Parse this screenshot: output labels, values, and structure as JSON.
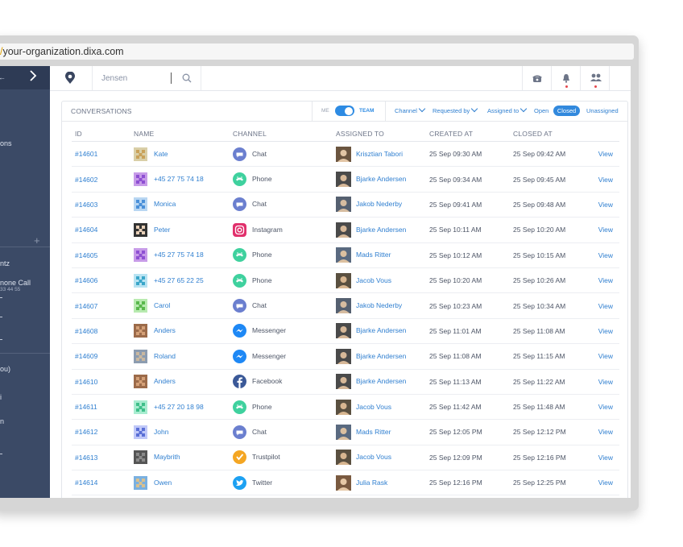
{
  "browser": {
    "url_prefix": "/",
    "url_host": "your-organization.dixa.com"
  },
  "sidebar": {
    "collapse_arrow_label": "",
    "fragments": [
      "ons",
      "ntz",
      "none Call",
      "33 44 55",
      "ou)",
      "i",
      "n"
    ]
  },
  "topbar": {
    "search_value": "Jensen"
  },
  "panel": {
    "title": "CONVERSATIONS",
    "toggle": {
      "me_label": "ME",
      "team_label": "TEAM"
    },
    "filters": {
      "channel": "Channel",
      "requested_by": "Requested by",
      "assigned_to": "Assigned to",
      "open": "Open",
      "closed": "Closed",
      "unassigned": "Unassigned"
    }
  },
  "table": {
    "headers": [
      "ID",
      "NAME",
      "CHANNEL",
      "ASSIGNED TO",
      "CREATED AT",
      "CLOSED AT"
    ],
    "view_label": "View",
    "rows": [
      {
        "id": "#14601",
        "name": "Kate",
        "channel": "Chat",
        "assigned": "Krisztian Tabori",
        "created": "25 Sep 09:30 AM",
        "closed": "25 Sep 09:42 AM"
      },
      {
        "id": "#14602",
        "name": "+45 27 75 74 18",
        "channel": "Phone",
        "assigned": "Bjarke Andersen",
        "created": "25 Sep 09:34 AM",
        "closed": "25 Sep 09:45 AM"
      },
      {
        "id": "#14603",
        "name": "Monica",
        "channel": "Chat",
        "assigned": "Jakob Nederby",
        "created": "25 Sep 09:41 AM",
        "closed": "25 Sep 09:48 AM"
      },
      {
        "id": "#14604",
        "name": "Peter",
        "channel": "Instagram",
        "assigned": "Bjarke Andersen",
        "created": "25 Sep 10:11 AM",
        "closed": "25 Sep 10:20 AM"
      },
      {
        "id": "#14605",
        "name": "+45 27 75 74 18",
        "channel": "Phone",
        "assigned": "Mads Ritter",
        "created": "25 Sep 10:12 AM",
        "closed": "25 Sep 10:15 AM"
      },
      {
        "id": "#14606",
        "name": "+45 27 65 22 25",
        "channel": "Phone",
        "assigned": "Jacob Vous",
        "created": "25 Sep 10:20 AM",
        "closed": "25 Sep 10:26 AM"
      },
      {
        "id": "#14607",
        "name": "Carol",
        "channel": "Chat",
        "assigned": "Jakob Nederby",
        "created": "25 Sep 10:23 AM",
        "closed": "25 Sep 10:34 AM"
      },
      {
        "id": "#14608",
        "name": "Anders",
        "channel": "Messenger",
        "assigned": "Bjarke Andersen",
        "created": "25 Sep 11:01 AM",
        "closed": "25 Sep 11:08 AM"
      },
      {
        "id": "#14609",
        "name": "Roland",
        "channel": "Messenger",
        "assigned": "Bjarke Andersen",
        "created": "25 Sep 11:08 AM",
        "closed": "25 Sep 11:15 AM"
      },
      {
        "id": "#14610",
        "name": "Anders",
        "channel": "Facebook",
        "assigned": "Bjarke Andersen",
        "created": "25 Sep 11:13 AM",
        "closed": "25 Sep 11:22 AM"
      },
      {
        "id": "#14611",
        "name": "+45 27 20 18 98",
        "channel": "Phone",
        "assigned": "Jacob Vous",
        "created": "25 Sep 11:42 AM",
        "closed": "25 Sep 11:48 AM"
      },
      {
        "id": "#14612",
        "name": "John",
        "channel": "Chat",
        "assigned": "Mads Ritter",
        "created": "25 Sep 12:05 PM",
        "closed": "25 Sep 12:12 PM"
      },
      {
        "id": "#14613",
        "name": "Maybrith",
        "channel": "Trustpilot",
        "assigned": "Jacob Vous",
        "created": "25 Sep 12:09 PM",
        "closed": "25 Sep 12:16 PM"
      },
      {
        "id": "#14614",
        "name": "Owen",
        "channel": "Twitter",
        "assigned": "Julia Rask",
        "created": "25 Sep 12:16 PM",
        "closed": "25 Sep 12:25 PM"
      }
    ]
  },
  "colors": {
    "sidebar_bg": "#3b4a66",
    "accent": "#2f7fd0",
    "chat": "#6b7fcf",
    "phone": "#3fd19e",
    "instagram": "#e1306c",
    "messenger": "#1e88f5",
    "facebook": "#3b5998",
    "trustpilot": "#f4a623",
    "twitter": "#1da1f2",
    "notification_dot": "#e5484d"
  },
  "icons": {
    "channels": {
      "Chat": "chat-bubble-icon",
      "Phone": "phone-icon",
      "Instagram": "instagram-icon",
      "Messenger": "messenger-icon",
      "Facebook": "facebook-icon",
      "Trustpilot": "trustpilot-icon",
      "Twitter": "twitter-icon"
    },
    "topbar": [
      "dixa-logo-icon",
      "search-icon",
      "telephone-icon",
      "bell-icon",
      "team-icon"
    ]
  }
}
